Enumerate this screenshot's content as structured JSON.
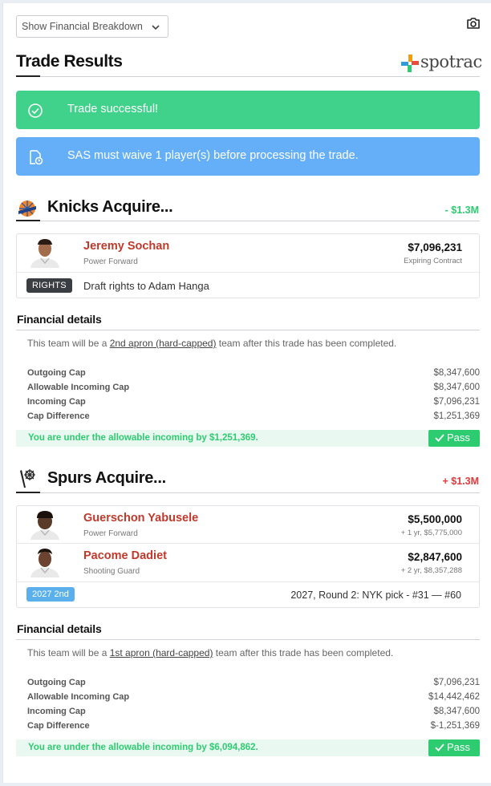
{
  "toolbar": {
    "view_select_value": "Show Financial Breakdown"
  },
  "header": {
    "title": "Trade Results",
    "logo_text": "spotrac"
  },
  "alerts": {
    "success": "Trade successful!",
    "info": "SAS must waive 1 player(s) before processing the trade."
  },
  "colors": {
    "success": "#40d18b",
    "info": "#64aff7",
    "player_name": "#c0392b",
    "pass": "#2ecc71"
  },
  "teams": [
    {
      "name": "Knicks Acquire...",
      "net": "- $1.3M",
      "net_color": "#2ecc71",
      "players": [
        {
          "name": "Jeremy Sochan",
          "position": "Power Forward",
          "salary": "$7,096,231",
          "contract": "Expiring Contract"
        }
      ],
      "asset": {
        "badge": "RIGHTS",
        "text": "Draft rights to Adam Hanga"
      },
      "financial": {
        "title": "Financial details",
        "note_prefix": "This team will be a ",
        "note_link": "2nd apron (hard-capped)",
        "note_suffix": " team after this trade has been completed.",
        "rows": [
          {
            "label": "Outgoing Cap",
            "value": "$8,347,600"
          },
          {
            "label": "Allowable Incoming Cap",
            "value": "$8,347,600"
          },
          {
            "label": "Incoming Cap",
            "value": "$7,096,231"
          },
          {
            "label": "Cap Difference",
            "value": "$1,251,369"
          }
        ],
        "result": "You are under the allowable incoming by $1,251,369.",
        "status": "Pass"
      }
    },
    {
      "name": "Spurs Acquire...",
      "net": "+ $1.3M",
      "net_color": "#e03a3a",
      "players": [
        {
          "name": "Guerschon Yabusele",
          "position": "Power Forward",
          "salary": "$5,500,000",
          "contract": "+ 1 yr, $5,775,000"
        },
        {
          "name": "Pacome Dadiet",
          "position": "Shooting Guard",
          "salary": "$2,847,600",
          "contract": "+ 2 yr, $8,357,288"
        }
      ],
      "asset": {
        "badge": "2027 2nd",
        "text": "2027, Round 2: NYK pick - #31 — #60"
      },
      "financial": {
        "title": "Financial details",
        "note_prefix": "This team will be a ",
        "note_link": "1st apron (hard-capped)",
        "note_suffix": " team after this trade has been completed.",
        "rows": [
          {
            "label": "Outgoing Cap",
            "value": "$7,096,231"
          },
          {
            "label": "Allowable Incoming Cap",
            "value": "$14,442,462"
          },
          {
            "label": "Incoming Cap",
            "value": "$8,347,600"
          },
          {
            "label": "Cap Difference",
            "value": "$-1,251,369"
          }
        ],
        "result": "You are under the allowable incoming by $6,094,862.",
        "status": "Pass"
      }
    }
  ]
}
